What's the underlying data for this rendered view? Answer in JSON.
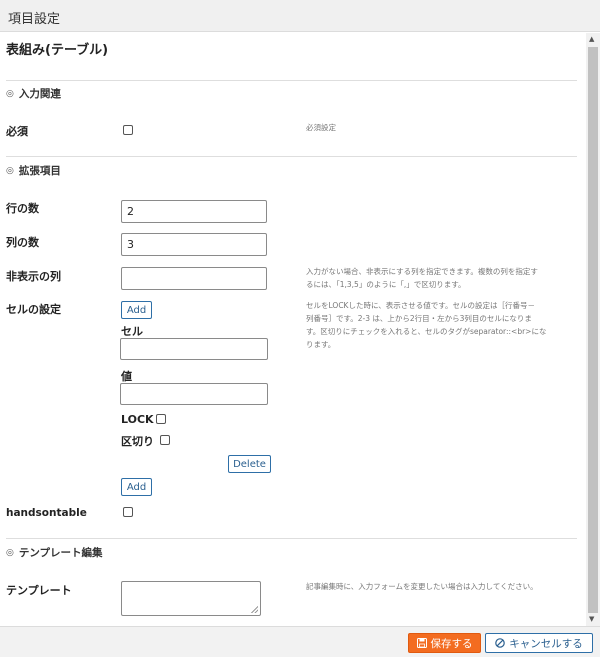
{
  "window": {
    "title": "項目設定"
  },
  "form": {
    "title": "表組み(テーブル)",
    "sections": {
      "input": "入力関連",
      "extended": "拡張項目",
      "template": "テンプレート編集"
    },
    "required": {
      "label": "必須",
      "help": "必須設定"
    },
    "rows": {
      "label": "行の数",
      "value": "2"
    },
    "cols": {
      "label": "列の数",
      "value": "3"
    },
    "hidden_cols": {
      "label": "非表示の列",
      "value": "",
      "help_1": "入力がない場合、非表示にする列を指定できます。複数の列を指定す",
      "help_2": "るには、「1,3,5」のように「,」で区切ります。"
    },
    "cell_settings": {
      "label": "セルの設定",
      "add_label": "Add",
      "cell_label": "セル",
      "cell_value": "",
      "value_label": "値",
      "value_value": "",
      "lock_label": "LOCK",
      "split_label": "区切り",
      "delete_label": "Delete",
      "add_label_2": "Add",
      "help_1": "セルをLOCKした時に、表示させる値です。セルの設定は［行番号－",
      "help_2": "列番号］です。2-3 は、上から2行目・左から3列目のセルになりま",
      "help_3": "す。区切りにチェックを入れると、セルのタグがseparator::<br>にな",
      "help_4": "ります。"
    },
    "handsontable": {
      "label": "handsontable"
    },
    "template": {
      "label": "テンプレート",
      "value": "",
      "help": "記事編集時に、入力フォームを変更したい場合は入力してください。"
    }
  },
  "footer": {
    "save_label": "保存する",
    "cancel_label": "キャンセルする"
  },
  "icons": {
    "section": "section-circle-icon",
    "save": "save-icon",
    "cancel": "cancel-circle-icon"
  },
  "colors": {
    "save": "#f36c20",
    "cancel_border": "#2e6fa7"
  }
}
